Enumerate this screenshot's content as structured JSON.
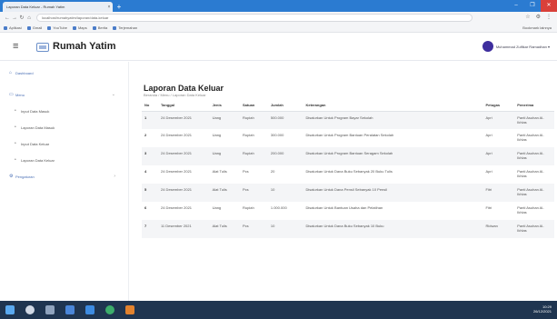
{
  "browser": {
    "tab_title": "Laporan Data Keluar - Rumah Yatim",
    "tab_close": "×",
    "new_tab": "+",
    "window_controls": [
      "–",
      "❐",
      "✕"
    ],
    "url": "localhost/rumahyatim/laporan/data-keluar",
    "bookmarks": [
      "Aplikasi",
      "Gmail",
      "YouTube",
      "Maps",
      "Berita",
      "Terjemahan"
    ],
    "other_bookmarks": "Bookmark lainnya"
  },
  "header": {
    "brand": "Rumah Yatim",
    "user_name": "Muhammad Zulfikar Ramadhan ▾"
  },
  "sidebar": {
    "dashboard": "Dashboard",
    "menu": "Menu",
    "items": [
      "Input Data Masuk",
      "Laporan Data Masuk",
      "Input Data Keluar",
      "Laporan Data Keluar"
    ],
    "pengaturan": "Pengaturan"
  },
  "page": {
    "title": "Laporan Data Keluar",
    "breadcrumb": "Beranda  /  Menu  /  Laporan Data Keluar"
  },
  "table": {
    "headers": [
      "No",
      "Tanggal",
      "Jenis",
      "Satuan",
      "Jumlah",
      "Keterangan",
      "Petugas",
      "Penerima"
    ],
    "rows": [
      {
        "no": "1",
        "tanggal": "24 Desember 2021",
        "jenis": "Uang",
        "satuan": "Rupiah",
        "jumlah": "500.000",
        "keterangan": "Disalurkan Untuk Program Bayar Sekolah",
        "petugas": "Apri",
        "penerima": "Panti Asuhan Al-Ikhlas"
      },
      {
        "no": "2",
        "tanggal": "24 Desember 2021",
        "jenis": "Uang",
        "satuan": "Rupiah",
        "jumlah": "300.000",
        "keterangan": "Disalurkan Untuk Program Bantuan Peralatan Sekolah",
        "petugas": "Apri",
        "penerima": "Panti Asuhan Al-Ikhlas"
      },
      {
        "no": "3",
        "tanggal": "24 Desember 2021",
        "jenis": "Uang",
        "satuan": "Rupiah",
        "jumlah": "200.000",
        "keterangan": "Disalurkan Untuk Program Bantuan Seragam Sekolah",
        "petugas": "Apri",
        "penerima": "Panti Asuhan Al-Ikhlas"
      },
      {
        "no": "4",
        "tanggal": "24 Desember 2021",
        "jenis": "Alat Tulis",
        "satuan": "Pcs",
        "jumlah": "20",
        "keterangan": "Disalurkan Untuk Dana Buku Sebanyak 20 Buku Tulis",
        "petugas": "Apri",
        "penerima": "Panti Asuhan Al-Ikhlas"
      },
      {
        "no": "5",
        "tanggal": "24 Desember 2021",
        "jenis": "Alat Tulis",
        "satuan": "Pcs",
        "jumlah": "10",
        "keterangan": "Disalurkan Untuk Dana Pensil Sebanyak 10 Pensil",
        "petugas": "Fitri",
        "penerima": "Panti Asuhan Al-Ikhlas"
      },
      {
        "no": "6",
        "tanggal": "24 Desember 2021",
        "jenis": "Uang",
        "satuan": "Rupiah",
        "jumlah": "1.000.000",
        "keterangan": "Disalurkan Untuk Bantuan Usaha dan Pelatihan",
        "petugas": "Fitri",
        "penerima": "Panti Asuhan Al-Ikhlas"
      },
      {
        "no": "7",
        "tanggal": "11 Desember 2021",
        "jenis": "Alat Tulis",
        "satuan": "Pcs",
        "jumlah": "10",
        "keterangan": "Disalurkan Untuk Dana Buku Sebanyak 10 Buku",
        "petugas": "Ridwan",
        "penerima": "Panti Asuhan Al-Ikhlas"
      }
    ]
  },
  "taskbar": {
    "time": "10:29",
    "date": "26/12/2021"
  },
  "colors": {
    "accent": "#2b7bd1",
    "link": "#4a6fb5",
    "avatar": "#3e2e9e",
    "taskbar": "#1f3550"
  }
}
